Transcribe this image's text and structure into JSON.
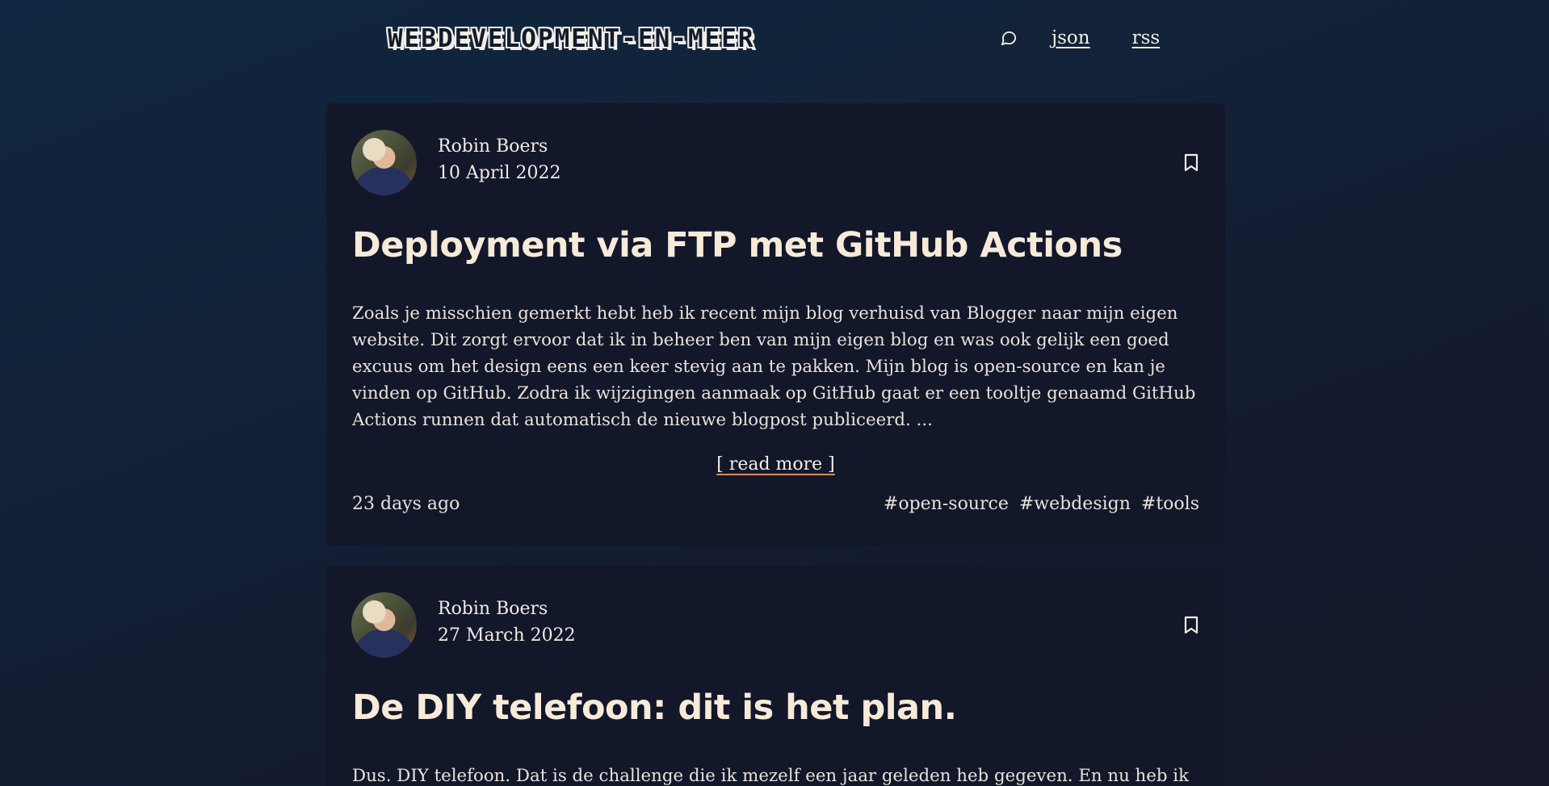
{
  "header": {
    "site_title": "WEBDEVELOPMENT-EN-MEER",
    "search_icon": "speech-bubble-search-icon",
    "nav": [
      {
        "label": "json"
      },
      {
        "label": "rss"
      }
    ]
  },
  "posts": [
    {
      "author": "Robin Boers",
      "date": "10 April 2022",
      "title": "Deployment via FTP met GitHub Actions",
      "excerpt": "Zoals je misschien gemerkt hebt heb ik recent mijn blog verhuisd van Blogger naar mijn eigen website. Dit zorgt ervoor dat ik in beheer ben van mijn eigen blog en was ook gelijk een goed excuus om het design eens een keer stevig aan te pakken. Mijn blog is open-source en kan je vinden op GitHub. Zodra ik wijzigingen aanmaak op GitHub gaat er een tooltje genaamd GitHub Actions runnen dat automatisch de nieuwe blogpost publiceerd. ...",
      "read_more": "[ read more ]",
      "relative_time": "23 days ago",
      "tags": [
        "#open-source",
        "#webdesign",
        "#tools"
      ]
    },
    {
      "author": "Robin Boers",
      "date": "27 March 2022",
      "title": "De DIY telefoon: dit is het plan.",
      "excerpt": "Dus. DIY telefoon. Dat is de challenge die ik mezelf een jaar geleden heb gegeven. En nu heb ik een"
    }
  ],
  "colors": {
    "card_bg": "#12172a",
    "title": "#f7ead9",
    "accent_underline": "#d98a5c"
  }
}
